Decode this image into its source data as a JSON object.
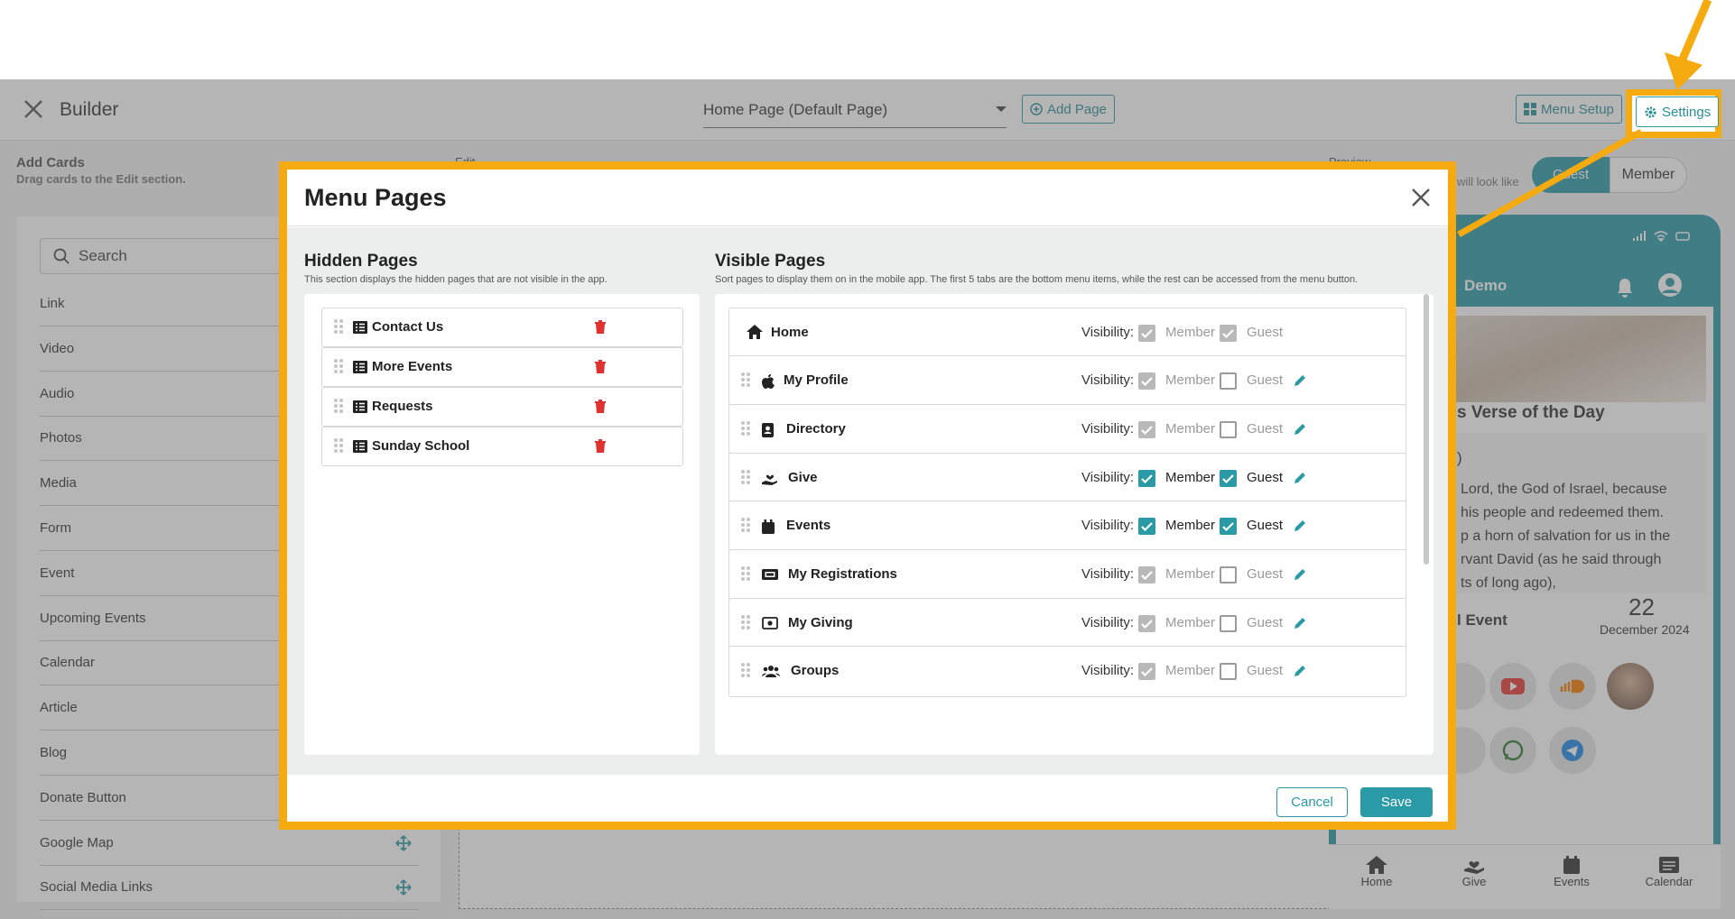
{
  "topbar": {
    "title": "Builder",
    "page_select": "Home Page (Default Page)",
    "add_page": "Add Page",
    "menu_setup": "Menu Setup",
    "settings": "Settings"
  },
  "left_panel": {
    "heading": "Add Cards",
    "subheading": "Drag cards to the Edit section.",
    "search_placeholder": "Search",
    "cards": [
      "Link",
      "Video",
      "Audio",
      "Photos",
      "Media",
      "Form",
      "Event",
      "Upcoming Events",
      "Calendar",
      "Article",
      "Blog",
      "Donate Button",
      "Google Map",
      "Social Media Links"
    ]
  },
  "center": {
    "edit_label": "Edit",
    "preview_label": "Preview"
  },
  "preview": {
    "hint": "will look like",
    "toggle": [
      "Guest",
      "Member"
    ],
    "app_name": "Demo",
    "verse_title": "s Verse of the Day",
    "verse_ref": ")",
    "verse_lines": [
      " Lord, the God of Israel, because",
      " his people and redeemed them.",
      "p a horn of salvation for us in the",
      "rvant David (as he said through",
      "ts of long ago),"
    ],
    "event_title": "l Event",
    "event_day": "22",
    "event_month": "December 2024",
    "bottom_nav": [
      "Home",
      "Give",
      "Events",
      "Calendar"
    ]
  },
  "modal": {
    "title": "Menu Pages",
    "hidden": {
      "title": "Hidden Pages",
      "desc": "This section displays the hidden pages that are not visible in the app.",
      "items": [
        "Contact Us",
        "More Events",
        "Requests",
        "Sunday School"
      ]
    },
    "visible": {
      "title": "Visible Pages",
      "desc": "Sort pages to display them on in the mobile app. The first 5 tabs are the bottom menu items, while the rest can be accessed from the menu button.",
      "visibility_label": "Visibility:",
      "member_label": "Member",
      "guest_label": "Guest",
      "items": [
        {
          "name": "Home",
          "icon": "home-icon",
          "member": "locked",
          "guest": "locked",
          "editable": false
        },
        {
          "name": "My Profile",
          "icon": "apple-icon",
          "member": "locked",
          "guest": "off",
          "editable": true
        },
        {
          "name": "Directory",
          "icon": "contact-card-icon",
          "member": "locked",
          "guest": "off",
          "editable": true
        },
        {
          "name": "Give",
          "icon": "give-hand-icon",
          "member": "on",
          "guest": "on",
          "editable": true
        },
        {
          "name": "Events",
          "icon": "calendar-icon",
          "member": "on",
          "guest": "on",
          "editable": true
        },
        {
          "name": "My Registrations",
          "icon": "ticket-icon",
          "member": "locked",
          "guest": "off",
          "editable": true
        },
        {
          "name": "My Giving",
          "icon": "money-icon",
          "member": "locked",
          "guest": "off",
          "editable": true
        },
        {
          "name": "Groups",
          "icon": "users-icon",
          "member": "locked",
          "guest": "off",
          "editable": true
        }
      ]
    },
    "cancel": "Cancel",
    "save": "Save"
  },
  "colors": {
    "accent": "#2a9aa6",
    "highlight": "#f5aa10",
    "danger": "#e03131"
  }
}
